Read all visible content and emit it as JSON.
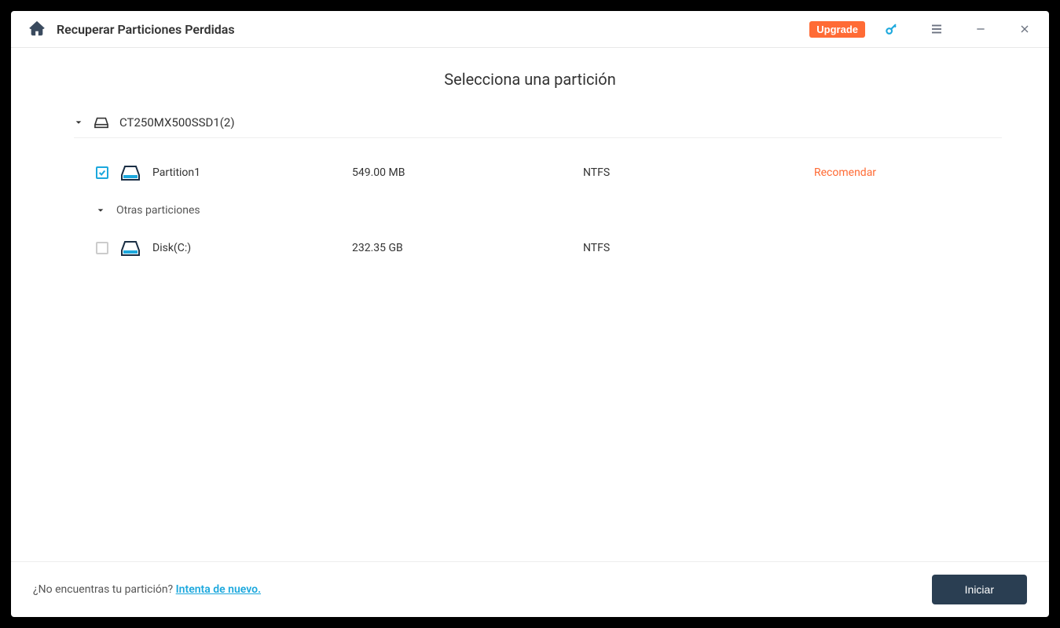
{
  "titlebar": {
    "title": "Recuperar Particiones Perdidas",
    "upgrade": "Upgrade"
  },
  "content": {
    "heading": "Selecciona una partición",
    "disk": {
      "name": "CT250MX500SSD1(2)",
      "partitions": [
        {
          "checked": true,
          "name": "Partition1",
          "size": "549.00 MB",
          "fs": "NTFS",
          "status": "Recomendar"
        }
      ],
      "subgroup_label": "Otras particiones",
      "other": [
        {
          "checked": false,
          "name": "Disk(C:)",
          "size": "232.35 GB",
          "fs": "NTFS",
          "status": ""
        }
      ]
    }
  },
  "footer": {
    "question": "¿No encuentras tu partición? ",
    "link": "Intenta de nuevo.",
    "start": "Iniciar"
  }
}
